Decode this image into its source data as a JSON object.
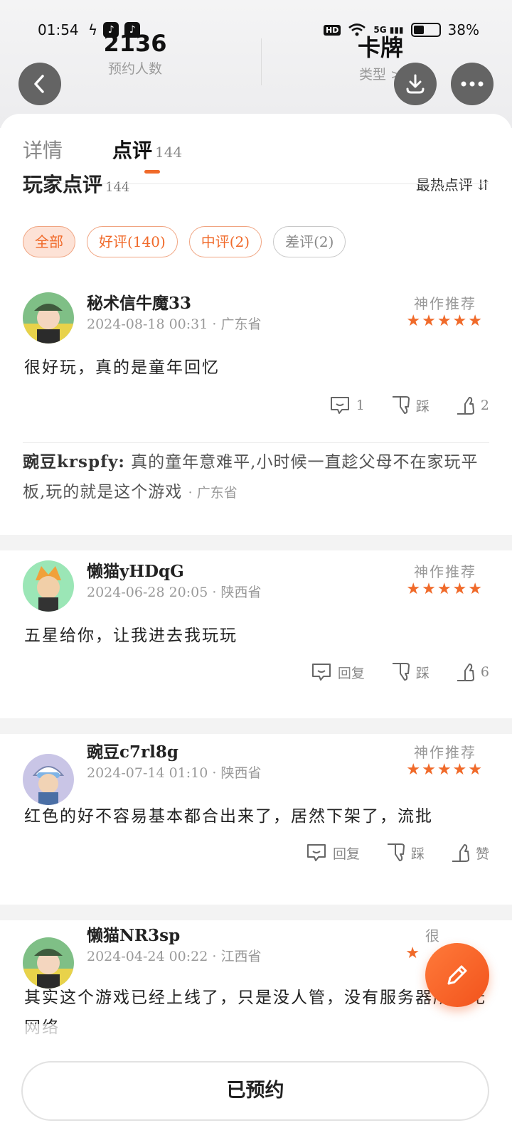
{
  "status_bar": {
    "time": "01:54",
    "network": "5G",
    "battery": "38%"
  },
  "header": {
    "stats": [
      {
        "value": "2136",
        "label": "预约人数"
      },
      {
        "value": "卡牌",
        "label": "类型 >"
      }
    ]
  },
  "tabs": [
    {
      "label": "详情"
    },
    {
      "label": "点评",
      "count": "144"
    }
  ],
  "section": {
    "title": "玩家点评",
    "count": "144",
    "sort_label": "最热点评"
  },
  "filters": [
    {
      "label": "全部"
    },
    {
      "label": "好评(140)"
    },
    {
      "label": "中评(2)"
    },
    {
      "label": "差评(2)"
    }
  ],
  "reviews": [
    {
      "username": "秘术信牛魔33",
      "datetime": "2024-08-18 00:31",
      "province": "· 广东省",
      "recommend": "神作推荐",
      "stars": "★★★★★",
      "content": "很好玩，真的是童年回忆",
      "reply_label": "1",
      "dislike_label": "踩",
      "like_label": "2",
      "reply_preview": {
        "author": "豌豆krspfy:",
        "text": " 真的童年意难平,小时候一直趁父母不在家玩平板,玩的就是这个游戏",
        "province": "· 广东省"
      }
    },
    {
      "username": "懒猫yHDqG",
      "datetime": "2024-06-28 20:05",
      "province": "· 陕西省",
      "recommend": "神作推荐",
      "stars": "★★★★★",
      "content": "五星给你，让我进去我玩玩",
      "reply_label": "回复",
      "dislike_label": "踩",
      "like_label": "6"
    },
    {
      "username": "豌豆c7rl8g",
      "datetime": "2024-07-14 01:10",
      "province": "· 陕西省",
      "recommend": "神作推荐",
      "stars": "★★★★★",
      "content": "红色的好不容易基本都合出来了，居然下架了，流批",
      "reply_label": "回复",
      "dislike_label": "踩",
      "like_label": "赞"
    },
    {
      "username": "懒猫NR3sp",
      "datetime": "2024-04-24 00:22",
      "province": "· 江西省",
      "recommend": "很",
      "stars": "★",
      "content": "其实这个游戏已经上线了，只是没人管，没有服务器所以无网络"
    }
  ],
  "bottom": {
    "reserve_label": "已预约"
  },
  "colors": {
    "accent": "#f06a2a",
    "muted": "#999999"
  }
}
